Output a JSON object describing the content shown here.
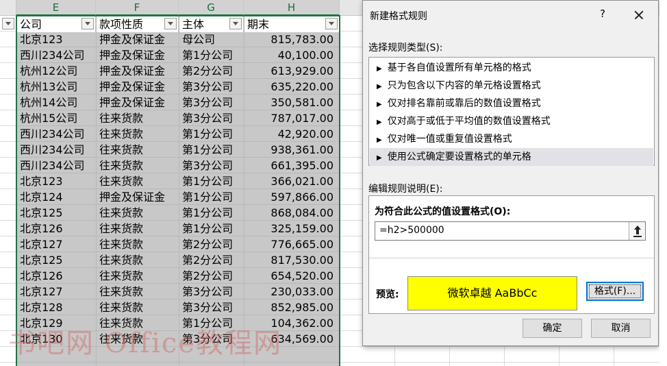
{
  "sheet": {
    "column_headers": [
      "E",
      "F",
      "G",
      "H"
    ],
    "table_headers": [
      "公司",
      "款项性质",
      "主体",
      "期末"
    ],
    "rows": [
      [
        "北京123",
        "押金及保证金",
        "母公司",
        "815,783.00"
      ],
      [
        "西川234公司",
        "押金及保证金",
        "第1分公司",
        "40,100.00"
      ],
      [
        "杭州12公司",
        "押金及保证金",
        "第2分公司",
        "613,929.00"
      ],
      [
        "杭州13公司",
        "押金及保证金",
        "第3分公司",
        "635,220.00"
      ],
      [
        "杭州14公司",
        "押金及保证金",
        "第3分公司",
        "350,581.00"
      ],
      [
        "杭州15公司",
        "往来货款",
        "第3分公司",
        "787,017.00"
      ],
      [
        "西川234公司",
        "往来货款",
        "第1分公司",
        "42,920.00"
      ],
      [
        "西川234公司",
        "往来货款",
        "第1分公司",
        "938,361.00"
      ],
      [
        "西川234公司",
        "往来货款",
        "第3分公司",
        "661,395.00"
      ],
      [
        "北京123",
        "往来货款",
        "第1分公司",
        "366,021.00"
      ],
      [
        "北京124",
        "押金及保证金",
        "第1分公司",
        "597,866.00"
      ],
      [
        "北京125",
        "往来货款",
        "第1分公司",
        "868,084.00"
      ],
      [
        "北京126",
        "往来货款",
        "第1分公司",
        "325,159.00"
      ],
      [
        "北京127",
        "往来货款",
        "第2分公司",
        "776,665.00"
      ],
      [
        "北京125",
        "往来货款",
        "第2分公司",
        "817,530.00"
      ],
      [
        "北京126",
        "往来货款",
        "第2分公司",
        "654,520.00"
      ],
      [
        "北京127",
        "往来货款",
        "第3分公司",
        "230,033.00"
      ],
      [
        "北京128",
        "往来货款",
        "第3分公司",
        "852,985.00"
      ],
      [
        "北京129",
        "往来货款",
        "第1分公司",
        "104,362.00"
      ],
      [
        "北京130",
        "往来货款",
        "第3分公司",
        "634,569.00"
      ]
    ],
    "watermark": "书吧网 Office教程网",
    "selection_color": "#217346"
  },
  "dialog": {
    "title": "新建格式规则",
    "help_label": "?",
    "rule_type_label": "选择规则类型(S):",
    "rule_types": [
      "基于各自值设置所有单元格的格式",
      "只为包含以下内容的单元格设置格式",
      "仅对排名靠前或靠后的数值设置格式",
      "仅对高于或低于平均值的数值设置格式",
      "仅对唯一值或重复值设置格式",
      "使用公式确定要设置格式的单元格"
    ],
    "selected_rule_index": 5,
    "edit_label": "编辑规则说明(E):",
    "formula_label": "为符合此公式的值设置格式(O):",
    "formula_value": "=h2>500000",
    "preview_label": "预览:",
    "preview_text": "微软卓越  AaBbCc",
    "preview_color": "#ffff00",
    "format_button": "格式(F)...",
    "ok_button": "确定",
    "cancel_button": "取消"
  }
}
